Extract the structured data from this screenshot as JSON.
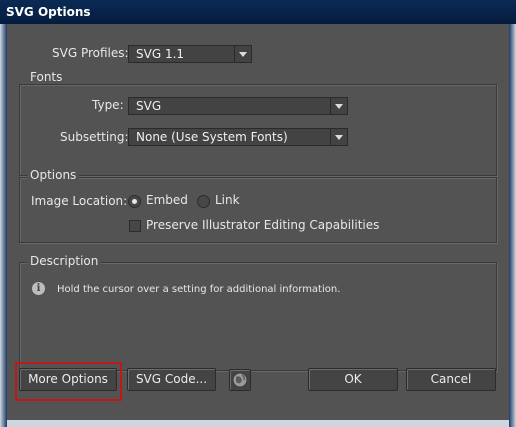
{
  "window": {
    "title": "SVG Options"
  },
  "profiles": {
    "label": "SVG Profiles:",
    "value": "SVG 1.1"
  },
  "fonts": {
    "title": "Fonts",
    "type_label": "Type:",
    "type_value": "SVG",
    "subsetting_label": "Subsetting:",
    "subsetting_value": "None (Use System Fonts)"
  },
  "options": {
    "title": "Options",
    "image_location_label": "Image Location:",
    "embed_label": "Embed",
    "link_label": "Link",
    "embed_selected": true,
    "preserve_label": "Preserve Illustrator Editing Capabilities",
    "preserve_checked": false
  },
  "description": {
    "title": "Description",
    "text": "Hold the cursor over a setting for additional information."
  },
  "buttons": {
    "more_options": "More Options",
    "svg_code": "SVG Code...",
    "ok": "OK",
    "cancel": "Cancel"
  },
  "icons": {
    "info": "info-icon",
    "globe": "globe-icon",
    "dropdown": "chevron-down-icon"
  },
  "colors": {
    "dialog_bg": "#535353",
    "highlight": "#c01818",
    "titlebar": "#0a2a55"
  }
}
